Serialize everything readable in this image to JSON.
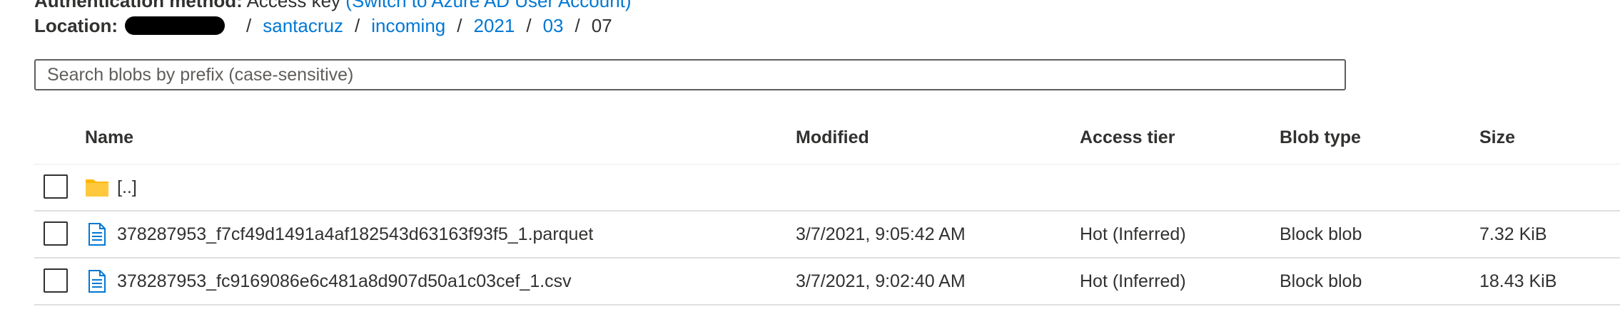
{
  "auth": {
    "label": "Authentication method:",
    "value": "Access key",
    "link": "(Switch to Azure AD User Account)"
  },
  "location": {
    "label": "Location:",
    "crumbs": [
      "santacruz",
      "incoming",
      "2021",
      "03",
      "07"
    ]
  },
  "search": {
    "placeholder": "Search blobs by prefix (case-sensitive)"
  },
  "table": {
    "headers": {
      "name": "Name",
      "modified": "Modified",
      "tier": "Access tier",
      "type": "Blob type",
      "size": "Size"
    },
    "parent": {
      "name": "[..]",
      "icon": "folder-icon"
    },
    "rows": [
      {
        "name": "378287953_f7cf49d1491a4af182543d63163f93f5_1.parquet",
        "modified": "3/7/2021, 9:05:42 AM",
        "tier": "Hot (Inferred)",
        "type": "Block blob",
        "size": "7.32 KiB",
        "icon": "file-icon"
      },
      {
        "name": "378287953_fc9169086e6c481a8d907d50a1c03cef_1.csv",
        "modified": "3/7/2021, 9:02:40 AM",
        "tier": "Hot (Inferred)",
        "type": "Block blob",
        "size": "18.43 KiB",
        "icon": "file-icon"
      }
    ]
  },
  "colors": {
    "link": "#0078d4",
    "folder": "#ffb900",
    "text": "#323130"
  }
}
